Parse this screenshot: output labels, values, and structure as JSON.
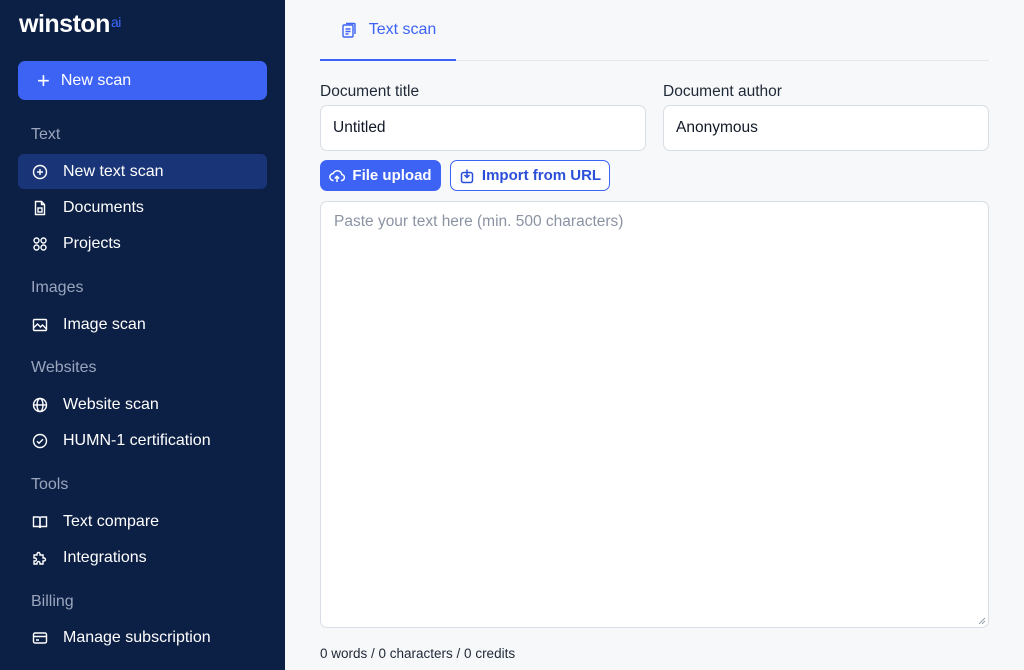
{
  "brand": {
    "name": "winston",
    "suffix": "ai"
  },
  "sidebar": {
    "new_scan_label": "New scan",
    "sections": {
      "text": "Text",
      "images": "Images",
      "websites": "Websites",
      "tools": "Tools",
      "billing": "Billing"
    },
    "items": {
      "new_text_scan": "New text scan",
      "documents": "Documents",
      "projects": "Projects",
      "image_scan": "Image scan",
      "website_scan": "Website scan",
      "humn_certification": "HUMN-1 certification",
      "text_compare": "Text compare",
      "integrations": "Integrations",
      "manage_subscription": "Manage subscription"
    },
    "active_item": "new_text_scan"
  },
  "main": {
    "tab_label": "Text scan",
    "document_title_label": "Document title",
    "document_title_value": "Untitled",
    "document_author_label": "Document author",
    "document_author_value": "Anonymous",
    "file_upload_label": "File upload",
    "import_url_label": "Import from URL",
    "textarea_placeholder": "Paste your text here (min. 500 characters)",
    "counter_text": "0 words / 0 characters / 0 credits"
  },
  "colors": {
    "sidebar_bg": "#0c1f44",
    "accent": "#3d63f5",
    "active_item_bg": "#1a3577"
  }
}
